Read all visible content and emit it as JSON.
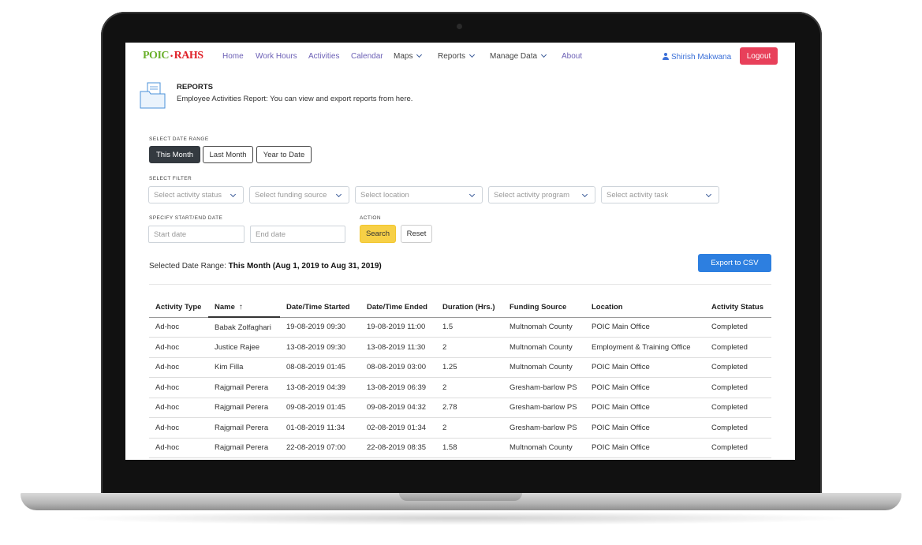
{
  "nav": {
    "logo_left": "POIC",
    "logo_sep": "•",
    "logo_right": "RAHS",
    "links": [
      "Home",
      "Work Hours",
      "Activities",
      "Calendar"
    ],
    "dropdowns": [
      "Maps",
      "Reports",
      "Manage Data"
    ],
    "about": "About",
    "user": "Shirish Makwana",
    "logout": "Logout"
  },
  "header": {
    "title": "REPORTS",
    "subtitle": "Employee Activities Report: You can view and export reports from here."
  },
  "date_range": {
    "label": "SELECT DATE RANGE",
    "options": [
      "This Month",
      "Last Month",
      "Year to Date"
    ],
    "active": "This Month"
  },
  "filter": {
    "label": "SELECT FILTER",
    "selects": [
      "Select activity status",
      "Select funding source",
      "Select location",
      "Select activity program",
      "Select activity task"
    ]
  },
  "dates": {
    "label": "SPECIFY START/END DATE",
    "start_placeholder": "Start date",
    "end_placeholder": "End date"
  },
  "action": {
    "label": "ACTION",
    "search": "Search",
    "reset": "Reset"
  },
  "selected_range": {
    "prefix": "Selected Date Range: ",
    "value": "This Month (Aug 1, 2019 to Aug 31, 2019)"
  },
  "export_label": "Export to CSV",
  "table": {
    "columns": [
      "Activity Type",
      "Name",
      "Date/Time Started",
      "Date/Time Ended",
      "Duration (Hrs.)",
      "Funding Source",
      "Location",
      "Activity Status"
    ],
    "sort_arrow": "↑",
    "rows": [
      [
        "Ad-hoc",
        "Babak Zolfaghari",
        "19-08-2019 09:30",
        "19-08-2019 11:00",
        "1.5",
        "Multnomah County",
        "POIC Main Office",
        "Completed"
      ],
      [
        "Ad-hoc",
        "Justice Rajee",
        "13-08-2019 09:30",
        "13-08-2019 11:30",
        "2",
        "Multnomah County",
        "Employment & Training Office",
        "Completed"
      ],
      [
        "Ad-hoc",
        "Kim Filla",
        "08-08-2019 01:45",
        "08-08-2019 03:00",
        "1.25",
        "Multnomah County",
        "POIC Main Office",
        "Completed"
      ],
      [
        "Ad-hoc",
        "Rajgmail Perera",
        "13-08-2019 04:39",
        "13-08-2019 06:39",
        "2",
        "Gresham-barlow PS",
        "POIC Main Office",
        "Completed"
      ],
      [
        "Ad-hoc",
        "Rajgmail Perera",
        "09-08-2019 01:45",
        "09-08-2019 04:32",
        "2.78",
        "Gresham-barlow PS",
        "POIC Main Office",
        "Completed"
      ],
      [
        "Ad-hoc",
        "Rajgmail Perera",
        "01-08-2019 11:34",
        "02-08-2019 01:34",
        "2",
        "Gresham-barlow PS",
        "POIC Main Office",
        "Completed"
      ],
      [
        "Ad-hoc",
        "Rajgmail Perera",
        "22-08-2019 07:00",
        "22-08-2019 08:35",
        "1.58",
        "Multnomah County",
        "POIC Main Office",
        "Completed"
      ]
    ]
  }
}
